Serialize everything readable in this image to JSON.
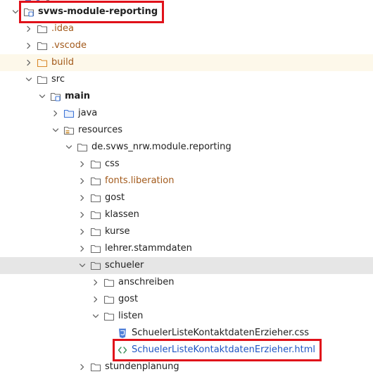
{
  "colors": {
    "highlight": "#e0111a",
    "excluded_text": "#a2591a",
    "file_link_text": "#1f55c4",
    "selection_bg": "#e6e6e6",
    "folder_stroke": "#6b6b6b",
    "excluded_folder_stroke": "#d9892a",
    "source_folder_stroke": "#3d74d6",
    "css_icon": "#4f7fd8",
    "html_icon": "#3c8f5a"
  },
  "tree": [
    {
      "label": "svws-module-reporting",
      "depth": 0,
      "expanded": true,
      "icon": "module-folder-icon",
      "bold": true,
      "highlighted": true
    },
    {
      "label": ".idea",
      "depth": 1,
      "expanded": false,
      "icon": "folder-icon",
      "style": "excluded"
    },
    {
      "label": ".vscode",
      "depth": 1,
      "expanded": false,
      "icon": "folder-icon",
      "style": "excluded"
    },
    {
      "label": "build",
      "depth": 1,
      "expanded": false,
      "icon": "excluded-folder-icon",
      "style": "excluded",
      "row_bg": "#fdf8ea"
    },
    {
      "label": "src",
      "depth": 1,
      "expanded": true,
      "icon": "folder-icon"
    },
    {
      "label": "main",
      "depth": 2,
      "expanded": true,
      "icon": "module-folder-icon",
      "bold": true
    },
    {
      "label": "java",
      "depth": 3,
      "expanded": false,
      "icon": "source-folder-icon"
    },
    {
      "label": "resources",
      "depth": 3,
      "expanded": true,
      "icon": "resources-folder-icon"
    },
    {
      "label": "de.svws_nrw.module.reporting",
      "depth": 4,
      "expanded": true,
      "icon": "folder-icon"
    },
    {
      "label": "css",
      "depth": 5,
      "expanded": false,
      "icon": "folder-icon"
    },
    {
      "label": "fonts.liberation",
      "depth": 5,
      "expanded": false,
      "icon": "folder-icon",
      "style": "excluded"
    },
    {
      "label": "gost",
      "depth": 5,
      "expanded": false,
      "icon": "folder-icon"
    },
    {
      "label": "klassen",
      "depth": 5,
      "expanded": false,
      "icon": "folder-icon"
    },
    {
      "label": "kurse",
      "depth": 5,
      "expanded": false,
      "icon": "folder-icon"
    },
    {
      "label": "lehrer.stammdaten",
      "depth": 5,
      "expanded": false,
      "icon": "folder-icon"
    },
    {
      "label": "schueler",
      "depth": 5,
      "expanded": true,
      "icon": "folder-icon",
      "selected": true
    },
    {
      "label": "anschreiben",
      "depth": 6,
      "expanded": false,
      "icon": "folder-icon"
    },
    {
      "label": "gost",
      "depth": 6,
      "expanded": false,
      "icon": "folder-icon"
    },
    {
      "label": "listen",
      "depth": 6,
      "expanded": true,
      "icon": "folder-icon"
    },
    {
      "label": "SchuelerListeKontaktdatenErzieher.css",
      "depth": 7,
      "leaf": true,
      "icon": "css-file-icon"
    },
    {
      "label": "SchuelerListeKontaktdatenErzieher.html",
      "depth": 7,
      "leaf": true,
      "icon": "html-file-icon",
      "style": "link",
      "highlighted": true
    },
    {
      "label": "stundenplanung",
      "depth": 5,
      "expanded": false,
      "icon": "folder-icon"
    }
  ]
}
